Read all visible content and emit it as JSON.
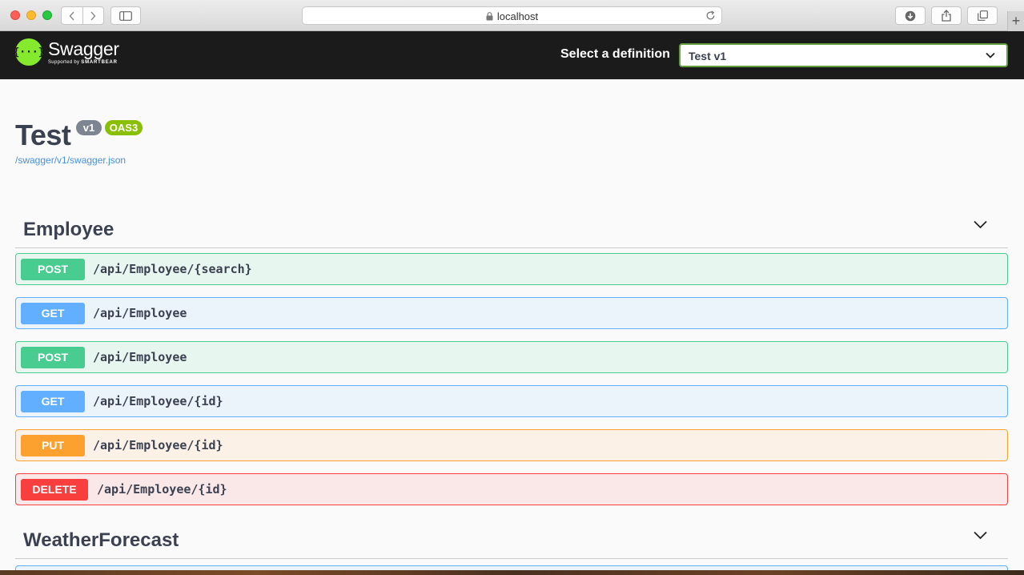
{
  "browser": {
    "address": "localhost"
  },
  "topbar": {
    "logo_name": "Swagger",
    "logo_sub_prefix": "Supported by",
    "logo_sub_brand": "SMARTBEAR",
    "definition_label": "Select a definition",
    "definition_selected": "Test v1"
  },
  "info": {
    "title": "Test",
    "version_badge": "v1",
    "oas_badge": "OAS3",
    "spec_url": "/swagger/v1/swagger.json"
  },
  "tags": [
    {
      "name": "Employee",
      "operations": [
        {
          "method": "POST",
          "path": "/api/Employee/{search}"
        },
        {
          "method": "GET",
          "path": "/api/Employee"
        },
        {
          "method": "POST",
          "path": "/api/Employee"
        },
        {
          "method": "GET",
          "path": "/api/Employee/{id}"
        },
        {
          "method": "PUT",
          "path": "/api/Employee/{id}"
        },
        {
          "method": "DELETE",
          "path": "/api/Employee/{id}"
        }
      ]
    },
    {
      "name": "WeatherForecast"
    }
  ],
  "colors": {
    "post": "#49cc90",
    "get": "#61affe",
    "put": "#fca130",
    "delete": "#f93e3e",
    "topbar": "#1b1b1b",
    "swagger_green": "#85ea2d"
  }
}
